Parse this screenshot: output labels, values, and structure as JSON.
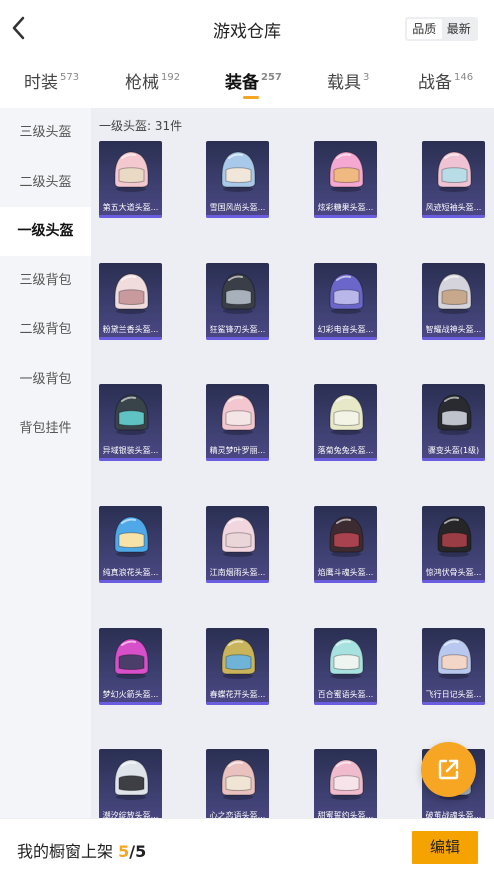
{
  "header": {
    "title": "游戏仓库",
    "back_icon": "chevron-left-icon",
    "sort": [
      {
        "label": "品质",
        "active": true
      },
      {
        "label": "最新",
        "active": false
      }
    ]
  },
  "tabs": [
    {
      "label": "时装",
      "count": "573",
      "active": false
    },
    {
      "label": "枪械",
      "count": "192",
      "active": false
    },
    {
      "label": "装备",
      "count": "257",
      "active": true
    },
    {
      "label": "载具",
      "count": "3",
      "active": false
    },
    {
      "label": "战备",
      "count": "146",
      "active": false
    }
  ],
  "sidebar": {
    "items": [
      {
        "label": "三级头盔",
        "active": false
      },
      {
        "label": "二级头盔",
        "active": false
      },
      {
        "label": "一级头盔",
        "active": true
      },
      {
        "label": "三级背包",
        "active": false
      },
      {
        "label": "二级背包",
        "active": false
      },
      {
        "label": "一级背包",
        "active": false
      },
      {
        "label": "背包挂件",
        "active": false
      }
    ]
  },
  "main": {
    "section_title": "一级头盔: 31件",
    "items": [
      {
        "name": "第五大道头盔...",
        "color": "#f3c9cf",
        "visor": "#e9d9c5"
      },
      {
        "name": "雪国风尚头盔...",
        "color": "#a9c9ea",
        "visor": "#f0e7da"
      },
      {
        "name": "炫彩糖果头盔...",
        "color": "#f5a8d2",
        "visor": "#f1b982"
      },
      {
        "name": "风迹短袖头盔...",
        "color": "#f0c3d4",
        "visor": "#b9dde6"
      },
      {
        "name": "粉黛兰香头盔...",
        "color": "#f0dcdc",
        "visor": "#c89a9e"
      },
      {
        "name": "狂鲨锋刃头盔...",
        "color": "#3a3e47",
        "visor": "#a8b1bb"
      },
      {
        "name": "幻彩电音头盔...",
        "color": "#6b66c9",
        "visor": "#b9b7e9"
      },
      {
        "name": "智耀战神头盔...",
        "color": "#d5d4dc",
        "visor": "#c7a88d"
      },
      {
        "name": "异域银装头盔...",
        "color": "#39434a",
        "visor": "#5ec3c2"
      },
      {
        "name": "精灵梦叶罗丽...",
        "color": "#f3c7cf",
        "visor": "#f4e6e6"
      },
      {
        "name": "落菊兔兔头盔...",
        "color": "#e6e8c8",
        "visor": "#f3f3e6"
      },
      {
        "name": "骤变头盔(1级)",
        "color": "#2a2b30",
        "visor": "#bfc3cc"
      },
      {
        "name": "纯真浪花头盔...",
        "color": "#4fa9e8",
        "visor": "#f7e2a8"
      },
      {
        "name": "江南烟雨头盔...",
        "color": "#f1d5df",
        "visor": "#ead6d9"
      },
      {
        "name": "焰鹰斗魂头盔...",
        "color": "#3c2b30",
        "visor": "#a8424e"
      },
      {
        "name": "惊鸿伏骨头盔...",
        "color": "#262628",
        "visor": "#9a3d44"
      },
      {
        "name": "梦幻火箭头盔...",
        "color": "#d74fc9",
        "visor": "#4a3f69"
      },
      {
        "name": "春蝶花开头盔...",
        "color": "#c9b35b",
        "visor": "#6fb4d6"
      },
      {
        "name": "百合蜜语头盔...",
        "color": "#a7e1e0",
        "visor": "#eef5f1"
      },
      {
        "name": "飞行日记头盔...",
        "color": "#b8c8ee",
        "visor": "#f4d6c7"
      },
      {
        "name": "潮汐绽放头盔...",
        "color": "#dfe3ea",
        "visor": "#3e3e45"
      },
      {
        "name": "心之恋语头盔...",
        "color": "#e9c2c0",
        "visor": "#f0e5d5"
      },
      {
        "name": "甜蜜誓约头盔...",
        "color": "#f0bccd",
        "visor": "#f6e4ea"
      },
      {
        "name": "破茧战魂头盔...",
        "color": "#a4b2c7",
        "visor": "#e5e1d8"
      }
    ]
  },
  "fab_icon": "share-external-icon",
  "bottom": {
    "label": "我的橱窗上架",
    "count": "5",
    "total": "/5",
    "edit_label": "编辑"
  }
}
